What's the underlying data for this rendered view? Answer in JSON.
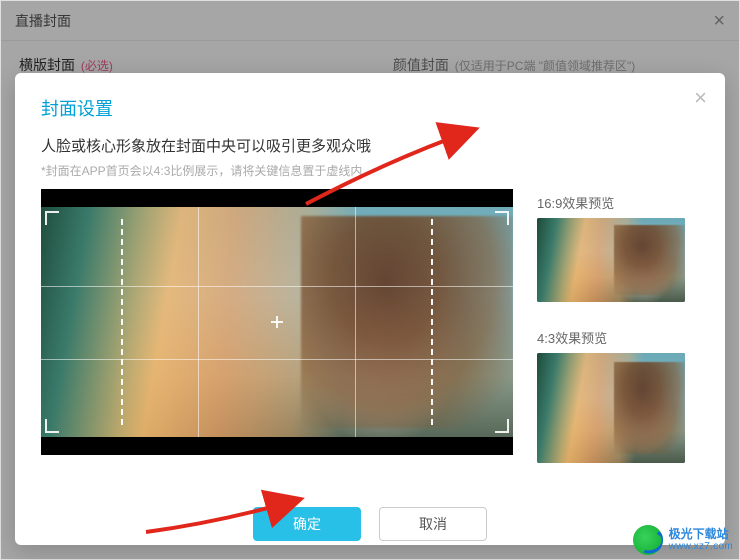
{
  "outer": {
    "title": "直播封面",
    "tabs": [
      {
        "label": "横版封面",
        "required_tag": "(必选)"
      },
      {
        "label": "颜值封面",
        "note": "(仅适用于PC端 \"颜值领域推荐区\")"
      }
    ]
  },
  "modal": {
    "title": "封面设置",
    "heading": "人脸或核心形象放在封面中央可以吸引更多观众哦",
    "subnote": "*封面在APP首页会以4:3比例展示，请将关键信息置于虚线内",
    "preview_16x9_label": "16:9效果预览",
    "preview_4x3_label": "4:3效果预览",
    "confirm_label": "确定",
    "cancel_label": "取消"
  },
  "watermark": {
    "name": "极光下载站",
    "url": "www.xz7.com"
  }
}
